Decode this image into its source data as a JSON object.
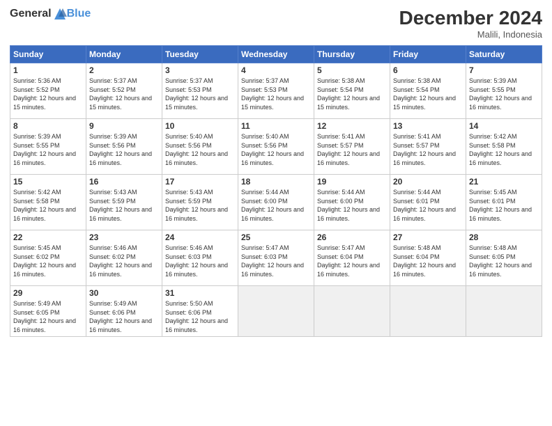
{
  "logo": {
    "general": "General",
    "blue": "Blue"
  },
  "header": {
    "month": "December 2024",
    "location": "Malili, Indonesia"
  },
  "weekdays": [
    "Sunday",
    "Monday",
    "Tuesday",
    "Wednesday",
    "Thursday",
    "Friday",
    "Saturday"
  ],
  "weeks": [
    [
      {
        "day": "1",
        "sunrise": "5:36 AM",
        "sunset": "5:52 PM",
        "daylight": "12 hours and 15 minutes"
      },
      {
        "day": "2",
        "sunrise": "5:37 AM",
        "sunset": "5:52 PM",
        "daylight": "12 hours and 15 minutes"
      },
      {
        "day": "3",
        "sunrise": "5:37 AM",
        "sunset": "5:53 PM",
        "daylight": "12 hours and 15 minutes"
      },
      {
        "day": "4",
        "sunrise": "5:37 AM",
        "sunset": "5:53 PM",
        "daylight": "12 hours and 15 minutes"
      },
      {
        "day": "5",
        "sunrise": "5:38 AM",
        "sunset": "5:54 PM",
        "daylight": "12 hours and 15 minutes"
      },
      {
        "day": "6",
        "sunrise": "5:38 AM",
        "sunset": "5:54 PM",
        "daylight": "12 hours and 15 minutes"
      },
      {
        "day": "7",
        "sunrise": "5:39 AM",
        "sunset": "5:55 PM",
        "daylight": "12 hours and 16 minutes"
      }
    ],
    [
      {
        "day": "8",
        "sunrise": "5:39 AM",
        "sunset": "5:55 PM",
        "daylight": "12 hours and 16 minutes"
      },
      {
        "day": "9",
        "sunrise": "5:39 AM",
        "sunset": "5:56 PM",
        "daylight": "12 hours and 16 minutes"
      },
      {
        "day": "10",
        "sunrise": "5:40 AM",
        "sunset": "5:56 PM",
        "daylight": "12 hours and 16 minutes"
      },
      {
        "day": "11",
        "sunrise": "5:40 AM",
        "sunset": "5:56 PM",
        "daylight": "12 hours and 16 minutes"
      },
      {
        "day": "12",
        "sunrise": "5:41 AM",
        "sunset": "5:57 PM",
        "daylight": "12 hours and 16 minutes"
      },
      {
        "day": "13",
        "sunrise": "5:41 AM",
        "sunset": "5:57 PM",
        "daylight": "12 hours and 16 minutes"
      },
      {
        "day": "14",
        "sunrise": "5:42 AM",
        "sunset": "5:58 PM",
        "daylight": "12 hours and 16 minutes"
      }
    ],
    [
      {
        "day": "15",
        "sunrise": "5:42 AM",
        "sunset": "5:58 PM",
        "daylight": "12 hours and 16 minutes"
      },
      {
        "day": "16",
        "sunrise": "5:43 AM",
        "sunset": "5:59 PM",
        "daylight": "12 hours and 16 minutes"
      },
      {
        "day": "17",
        "sunrise": "5:43 AM",
        "sunset": "5:59 PM",
        "daylight": "12 hours and 16 minutes"
      },
      {
        "day": "18",
        "sunrise": "5:44 AM",
        "sunset": "6:00 PM",
        "daylight": "12 hours and 16 minutes"
      },
      {
        "day": "19",
        "sunrise": "5:44 AM",
        "sunset": "6:00 PM",
        "daylight": "12 hours and 16 minutes"
      },
      {
        "day": "20",
        "sunrise": "5:44 AM",
        "sunset": "6:01 PM",
        "daylight": "12 hours and 16 minutes"
      },
      {
        "day": "21",
        "sunrise": "5:45 AM",
        "sunset": "6:01 PM",
        "daylight": "12 hours and 16 minutes"
      }
    ],
    [
      {
        "day": "22",
        "sunrise": "5:45 AM",
        "sunset": "6:02 PM",
        "daylight": "12 hours and 16 minutes"
      },
      {
        "day": "23",
        "sunrise": "5:46 AM",
        "sunset": "6:02 PM",
        "daylight": "12 hours and 16 minutes"
      },
      {
        "day": "24",
        "sunrise": "5:46 AM",
        "sunset": "6:03 PM",
        "daylight": "12 hours and 16 minutes"
      },
      {
        "day": "25",
        "sunrise": "5:47 AM",
        "sunset": "6:03 PM",
        "daylight": "12 hours and 16 minutes"
      },
      {
        "day": "26",
        "sunrise": "5:47 AM",
        "sunset": "6:04 PM",
        "daylight": "12 hours and 16 minutes"
      },
      {
        "day": "27",
        "sunrise": "5:48 AM",
        "sunset": "6:04 PM",
        "daylight": "12 hours and 16 minutes"
      },
      {
        "day": "28",
        "sunrise": "5:48 AM",
        "sunset": "6:05 PM",
        "daylight": "12 hours and 16 minutes"
      }
    ],
    [
      {
        "day": "29",
        "sunrise": "5:49 AM",
        "sunset": "6:05 PM",
        "daylight": "12 hours and 16 minutes"
      },
      {
        "day": "30",
        "sunrise": "5:49 AM",
        "sunset": "6:06 PM",
        "daylight": "12 hours and 16 minutes"
      },
      {
        "day": "31",
        "sunrise": "5:50 AM",
        "sunset": "6:06 PM",
        "daylight": "12 hours and 16 minutes"
      },
      null,
      null,
      null,
      null
    ]
  ]
}
